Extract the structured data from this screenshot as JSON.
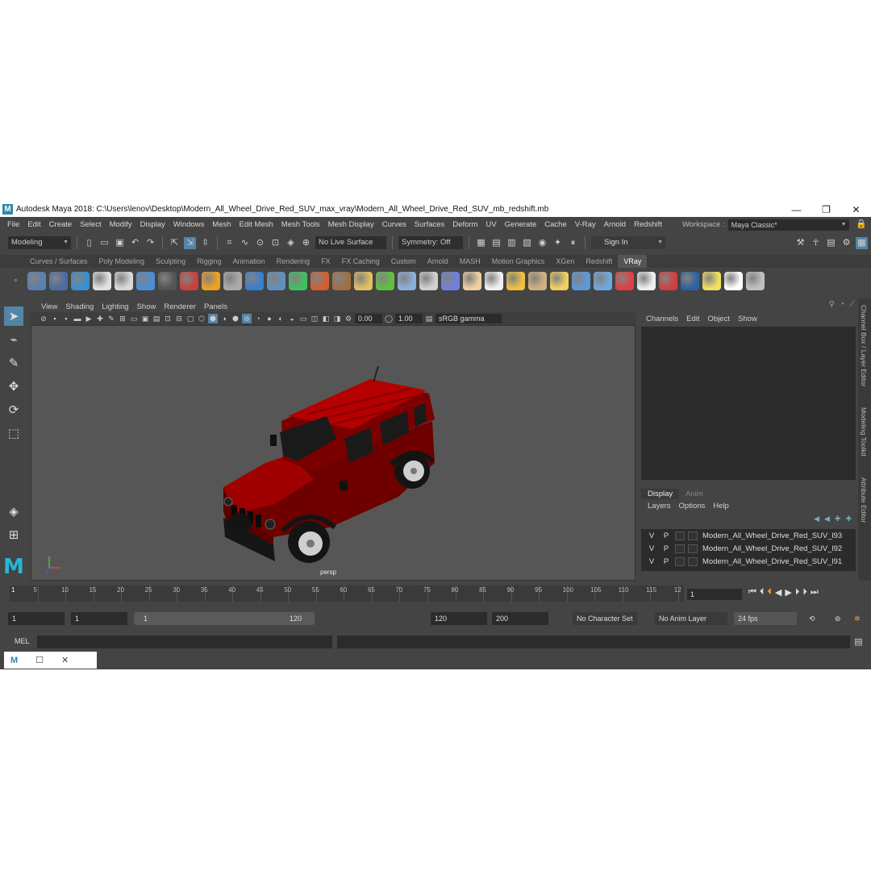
{
  "window": {
    "title": "Autodesk Maya 2018: C:\\Users\\lenov\\Desktop\\Modern_All_Wheel_Drive_Red_SUV_max_vray\\Modern_All_Wheel_Drive_Red_SUV_mb_redshift.mb",
    "logo_letter": "M",
    "min_glyph": "—",
    "max_glyph": "❐",
    "close_glyph": "✕"
  },
  "menu": [
    "File",
    "Edit",
    "Create",
    "Select",
    "Modify",
    "Display",
    "Windows",
    "Mesh",
    "Edit Mesh",
    "Mesh Tools",
    "Mesh Display",
    "Curves",
    "Surfaces",
    "Deform",
    "UV",
    "Generate",
    "Cache",
    "V-Ray",
    "Arnold",
    "Redshift"
  ],
  "workspace": {
    "label": "Workspace :",
    "value": "Maya Classic*"
  },
  "statusline": {
    "mode": "Modeling",
    "live_surface": "No Live Surface",
    "symmetry": "Symmetry: Off",
    "sign_in": "Sign In"
  },
  "shelf_tabs": [
    "Curves / Surfaces",
    "Poly Modeling",
    "Sculpting",
    "Rigging",
    "Animation",
    "Rendering",
    "FX",
    "FX Caching",
    "Custom",
    "Arnold",
    "MASH",
    "Motion Graphics",
    "XGen",
    "Redshift",
    "VRay"
  ],
  "shelf_active": "VRay",
  "shelf_icon_colors": [
    "#5a7fb0",
    "#4a6ea0",
    "#3a8fd0",
    "#e0e0e0",
    "#d8d8d8",
    "#4a8ed8",
    "#555",
    "#c84040",
    "#f0a020",
    "#aaa",
    "#3a7fd0",
    "#6090c0",
    "#40c060",
    "#d06030",
    "#a07040",
    "#e0c060",
    "#60c040",
    "#8ab0d8",
    "#d0d0d0",
    "#7080e0",
    "#f0d0a0",
    "#f0f0f0",
    "#f0c040",
    "#d0b080",
    "#f0d060",
    "#5a9ad8",
    "#6fa8e0",
    "#e04040",
    "#eeeeee",
    "#d04040",
    "#3060a0",
    "#f0e060",
    "#ffffff",
    "#c0c0c0"
  ],
  "panel_menu": [
    "View",
    "Shading",
    "Lighting",
    "Show",
    "Renderer",
    "Panels"
  ],
  "panel_fields": {
    "exposure": "0.00",
    "gamma": "1.00",
    "colorspace": "sRGB gamma"
  },
  "viewport": {
    "camera": "persp",
    "bg": "#565656",
    "car_color": "#8e0000"
  },
  "channel_box": {
    "menu": [
      "Channels",
      "Edit",
      "Object",
      "Show"
    ]
  },
  "layer_editor": {
    "tabs": [
      "Display",
      "Anim"
    ],
    "menu": [
      "Layers",
      "Options",
      "Help"
    ],
    "layers": [
      {
        "v": "V",
        "p": "P",
        "name": "Modern_All_Wheel_Drive_Red_SUV_l93"
      },
      {
        "v": "V",
        "p": "P",
        "name": "Modern_All_Wheel_Drive_Red_SUV_l92"
      },
      {
        "v": "V",
        "p": "P",
        "name": "Modern_All_Wheel_Drive_Red_SUV_l91"
      }
    ]
  },
  "side_tabs": [
    "Channel Box / Layer Editor",
    "Modeling Toolkit",
    "Attribute Editor"
  ],
  "timeline": {
    "ticks": [
      "5",
      "10",
      "15",
      "20",
      "25",
      "30",
      "35",
      "40",
      "45",
      "50",
      "55",
      "60",
      "65",
      "70",
      "75",
      "80",
      "85",
      "90",
      "95",
      "100",
      "105",
      "110",
      "115",
      "12"
    ],
    "start_label": "1",
    "current_frame": "1"
  },
  "range": {
    "start": "1",
    "playback_start": "1",
    "slider_lo": "1",
    "slider_hi": "120",
    "playback_end": "120",
    "end": "200",
    "character_set": "No Character Set",
    "anim_layer": "No Anim Layer",
    "fps": "24 fps"
  },
  "command": {
    "label": "MEL"
  }
}
